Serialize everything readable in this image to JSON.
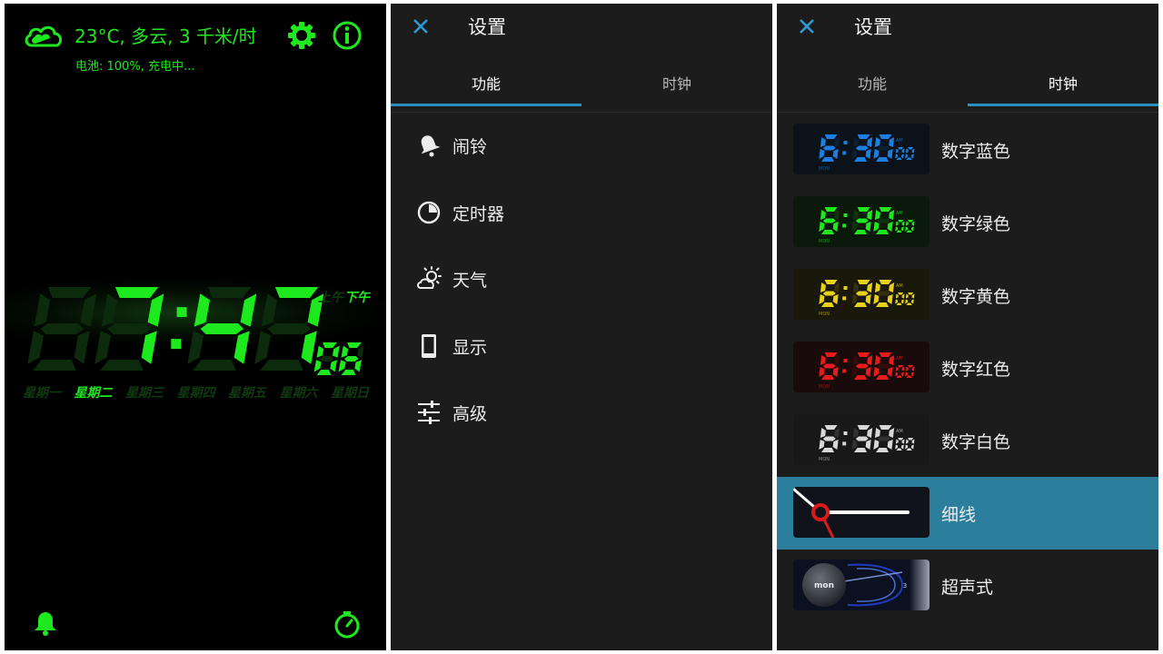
{
  "clock_screen": {
    "weather_text": "23°C, 多云, 3 千米/时",
    "battery_text": "电池: 100%, 充电中...",
    "time_hours": "7",
    "time_minutes": "47",
    "time_seconds": "06",
    "am_label": "上午",
    "pm_label": "下午",
    "weekdays": [
      "星期一",
      "星期二",
      "星期三",
      "星期四",
      "星期五",
      "星期六",
      "星期日"
    ],
    "active_weekday": "星期二",
    "color_active": "#1ee81e",
    "color_dim": "#0c2a0c"
  },
  "settings_left": {
    "title": "设置",
    "tabs": [
      {
        "label": "功能",
        "active": true
      },
      {
        "label": "时钟",
        "active": false
      }
    ],
    "menu": [
      {
        "label": "闹铃",
        "icon": "bell-icon"
      },
      {
        "label": "定时器",
        "icon": "timer-icon"
      },
      {
        "label": "天气",
        "icon": "weather-icon"
      },
      {
        "label": "显示",
        "icon": "phone-icon"
      },
      {
        "label": "高级",
        "icon": "sliders-icon"
      }
    ]
  },
  "settings_right": {
    "title": "设置",
    "tabs": [
      {
        "label": "功能",
        "active": false
      },
      {
        "label": "时钟",
        "active": true
      }
    ],
    "faces": [
      {
        "label": "数字蓝色",
        "color": "#1a7fe0",
        "selected": false
      },
      {
        "label": "数字绿色",
        "color": "#1ee81e",
        "selected": false
      },
      {
        "label": "数字黄色",
        "color": "#e6d21a",
        "selected": false
      },
      {
        "label": "数字红色",
        "color": "#e81a1a",
        "selected": false
      },
      {
        "label": "数字白色",
        "color": "#d8d8d8",
        "selected": false
      },
      {
        "label": "细线",
        "color": "#ffffff",
        "selected": true
      },
      {
        "label": "超声式",
        "color": "#3a6cff",
        "selected": false
      }
    ],
    "thumb_time": "6:30",
    "thumb_seconds": "00",
    "thumb_ampm": "AM",
    "thumb_day": "MON",
    "ultrasonic_day": "mon",
    "ultrasonic_number": "3"
  },
  "accent": "#2b8fbf"
}
